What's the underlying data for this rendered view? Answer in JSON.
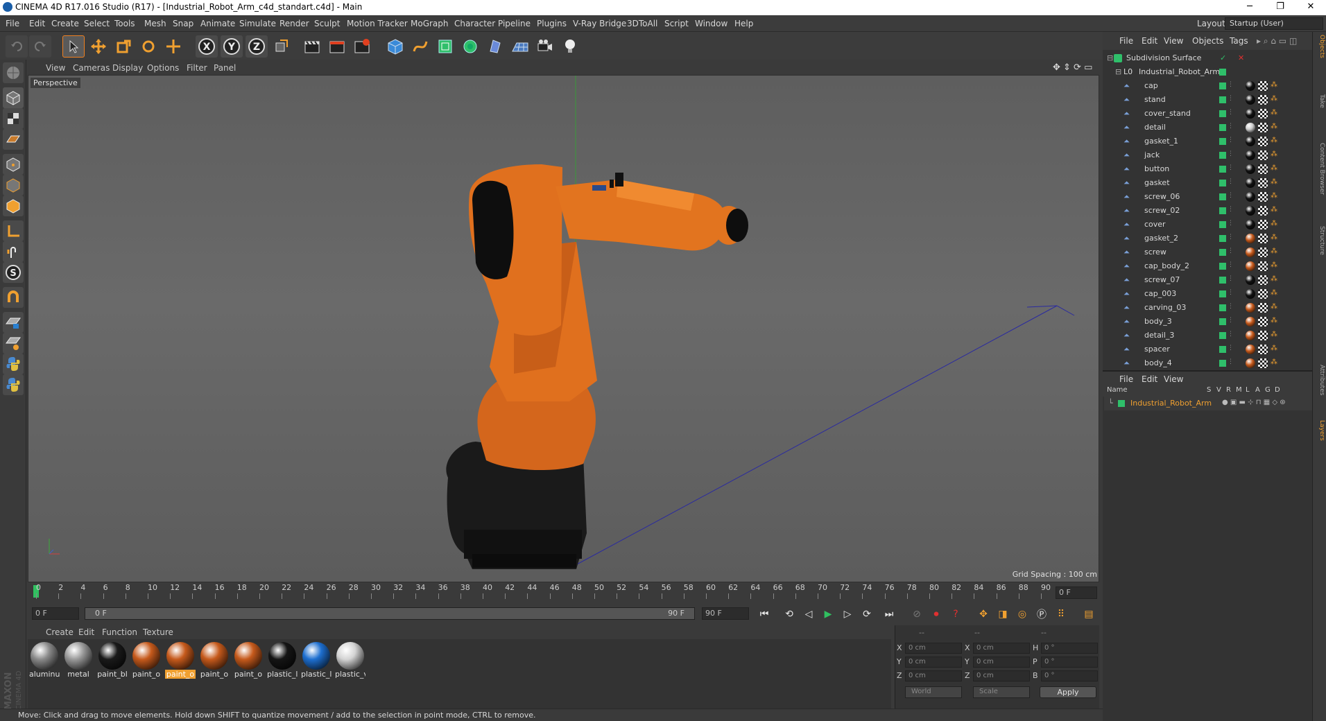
{
  "window": {
    "title": "CINEMA 4D R17.016 Studio (R17) - [Industrial_Robot_Arm_c4d_standart.c4d] - Main"
  },
  "menu": [
    "File",
    "Edit",
    "Create",
    "Select",
    "Tools",
    "Mesh",
    "Snap",
    "Animate",
    "Simulate",
    "Render",
    "Sculpt",
    "Motion Tracker",
    "MoGraph",
    "Character",
    "Pipeline",
    "Plugins",
    "V-Ray Bridge",
    "3DToAll",
    "Script",
    "Window",
    "Help"
  ],
  "layout": {
    "label": "Layout:",
    "value": "Startup (User)"
  },
  "viewport": {
    "menu": [
      "View",
      "Cameras",
      "Display",
      "Options",
      "Filter",
      "Panel"
    ],
    "label": "Perspective",
    "grid_spacing": "Grid Spacing : 100 cm"
  },
  "timeline": {
    "ticks": [
      "0",
      "2",
      "4",
      "6",
      "8",
      "10",
      "12",
      "14",
      "16",
      "18",
      "20",
      "22",
      "24",
      "26",
      "28",
      "30",
      "32",
      "34",
      "36",
      "38",
      "40",
      "42",
      "44",
      "46",
      "48",
      "50",
      "52",
      "54",
      "56",
      "58",
      "60",
      "62",
      "64",
      "66",
      "68",
      "70",
      "72",
      "74",
      "76",
      "78",
      "80",
      "82",
      "84",
      "86",
      "88",
      "90"
    ],
    "current_frame": "0 F"
  },
  "playback": {
    "start": "0 F",
    "slider_start": "0 F",
    "slider_end": "90 F",
    "end": "90 F"
  },
  "materials": {
    "menu": [
      "Create",
      "Edit",
      "Function",
      "Texture"
    ],
    "items": [
      {
        "label": "aluminu",
        "color": "#8a8a8a"
      },
      {
        "label": "metal",
        "color": "#9a9a9a"
      },
      {
        "label": "paint_bl",
        "color": "#1a1a1a"
      },
      {
        "label": "paint_o",
        "color": "#c65a1c"
      },
      {
        "label": "paint_o",
        "color": "#c65a1c"
      },
      {
        "label": "paint_o",
        "color": "#c65a1c"
      },
      {
        "label": "paint_o",
        "color": "#c65a1c"
      },
      {
        "label": "plastic_l",
        "color": "#151515"
      },
      {
        "label": "plastic_l",
        "color": "#1e6fd0"
      },
      {
        "label": "plastic_v",
        "color": "#d4d4d4"
      }
    ],
    "selected_index": 4
  },
  "coordinates": {
    "headers": [
      "--",
      "--",
      "--"
    ],
    "rows": [
      {
        "a": "X",
        "av": "0 cm",
        "b": "X",
        "bv": "0 cm",
        "c": "H",
        "cv": "0 °"
      },
      {
        "a": "Y",
        "av": "0 cm",
        "b": "Y",
        "bv": "0 cm",
        "c": "P",
        "cv": "0 °"
      },
      {
        "a": "Z",
        "av": "0 cm",
        "b": "Z",
        "bv": "0 cm",
        "c": "B",
        "cv": "0 °"
      }
    ],
    "world": "World",
    "scale": "Scale",
    "apply": "Apply"
  },
  "status": "Move: Click and drag to move elements. Hold down SHIFT to quantize movement / add to the selection in point mode, CTRL to remove.",
  "branding": [
    "MAXON",
    "CINEMA 4D"
  ],
  "objects": {
    "menu": [
      "File",
      "Edit",
      "View",
      "Objects",
      "Tags"
    ],
    "root": "Subdivision Surface",
    "group": "Industrial_Robot_Arm",
    "items": [
      {
        "name": "cap",
        "tag": "#111"
      },
      {
        "name": "stand",
        "tag": "#111"
      },
      {
        "name": "cover_stand",
        "tag": "#111"
      },
      {
        "name": "detail",
        "tag": "#ccc"
      },
      {
        "name": "gasket_1",
        "tag": "#111"
      },
      {
        "name": "jack",
        "tag": "#111"
      },
      {
        "name": "button",
        "tag": "#111"
      },
      {
        "name": "gasket",
        "tag": "#111"
      },
      {
        "name": "screw_06",
        "tag": "#111"
      },
      {
        "name": "screw_02",
        "tag": "#111"
      },
      {
        "name": "cover",
        "tag": "#111"
      },
      {
        "name": "gasket_2",
        "tag": "#c65a1c"
      },
      {
        "name": "screw",
        "tag": "#c65a1c"
      },
      {
        "name": "cap_body_2",
        "tag": "#c65a1c"
      },
      {
        "name": "screw_07",
        "tag": "#111"
      },
      {
        "name": "cap_003",
        "tag": "#111"
      },
      {
        "name": "carving_03",
        "tag": "#c65a1c"
      },
      {
        "name": "body_3",
        "tag": "#c65a1c"
      },
      {
        "name": "detail_3",
        "tag": "#c65a1c"
      },
      {
        "name": "spacer",
        "tag": "#c65a1c"
      },
      {
        "name": "body_4",
        "tag": "#c65a1c"
      }
    ]
  },
  "layers": {
    "menu": [
      "File",
      "Edit",
      "View"
    ],
    "columns": [
      "Name",
      "S",
      "V",
      "R",
      "M",
      "L",
      "A",
      "G",
      "D"
    ],
    "items": [
      {
        "name": "Industrial_Robot_Arm"
      }
    ]
  },
  "side_tabs": [
    "Objects",
    "Take",
    "Content Browser",
    "Structure",
    "Attributes",
    "Layers"
  ]
}
